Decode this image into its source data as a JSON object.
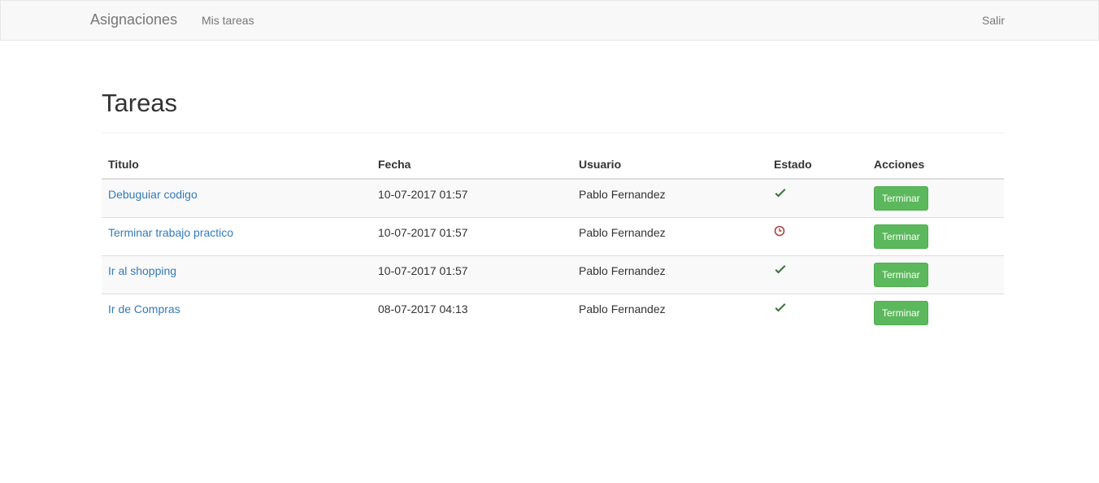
{
  "navbar": {
    "brand": "Asignaciones",
    "mis_tareas": "Mis tareas",
    "salir": "Salir"
  },
  "page": {
    "title": "Tareas"
  },
  "table": {
    "headers": [
      "Titulo",
      "Fecha",
      "Usuario",
      "Estado",
      "Acciones"
    ],
    "rows": [
      {
        "titulo": "Debuguiar codigo",
        "fecha": "10-07-2017 01:57",
        "usuario": "Pablo Fernandez",
        "estado": "check-icon",
        "accion": "Terminar"
      },
      {
        "titulo": "Terminar trabajo practico",
        "fecha": "10-07-2017 01:57",
        "usuario": "Pablo Fernandez",
        "estado": "clock-icon",
        "accion": "Terminar"
      },
      {
        "titulo": "Ir al shopping",
        "fecha": "10-07-2017 01:57",
        "usuario": "Pablo Fernandez",
        "estado": "check-icon",
        "accion": "Terminar"
      },
      {
        "titulo": "Ir de Compras",
        "fecha": "08-07-2017 04:13",
        "usuario": "Pablo Fernandez",
        "estado": "check-icon",
        "accion": "Terminar"
      }
    ]
  },
  "colors": {
    "check": "#3c763d",
    "clock": "#a94442",
    "button": "#5cb85c",
    "link": "#337ab7"
  }
}
